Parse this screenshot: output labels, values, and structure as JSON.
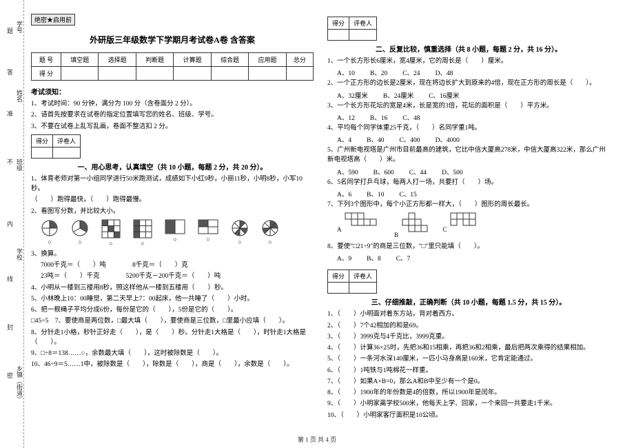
{
  "binding": {
    "fields": [
      "学号",
      "姓名",
      "班级",
      "学校",
      "乡镇（街道）"
    ],
    "marks": [
      "题",
      "答",
      "准",
      "不",
      "内",
      "线",
      "封",
      "密"
    ]
  },
  "secret": "绝密★启用前",
  "title": "外研版三年级数学下学期月考试卷A卷 含答案",
  "score_table": {
    "headers": [
      "题 号",
      "填空题",
      "选择题",
      "判断题",
      "计算题",
      "综合题",
      "应用题",
      "总分"
    ],
    "row2": "得 分"
  },
  "notice": {
    "head": "考试须知：",
    "items": [
      "1、考试时间：90 分钟，满分为 100 分（含卷面分 2 分）。",
      "2、请首先按要求在试卷的指定位置填写您的姓名、班级、学号。",
      "3、不要在试卷上乱写乱画，卷面不整洁扣 2 分。"
    ]
  },
  "scorebox": {
    "c1": "得分",
    "c2": "评卷人"
  },
  "sec1": {
    "title": "一、用心思考，认真填空（共 10 小题，每题 2 分，共 20 分）。",
    "q1a": "1、体育老师对第一小组同学进行50米跑测试，成绩如下小红9秒，小丽11秒，小明8秒，小军10秒。",
    "q1b": "（　　）跑得最快，（　　）跑得最慢。",
    "q2": "2、看图写分数，并比较大小。",
    "q3": "3、换算。",
    "q3a": "7000千克＝（　　）吨",
    "q3b": "8千克＝（　　）克",
    "q3c": "23吨＝（　　）千克",
    "q3d": "5200千克－200千克＝（　　）吨",
    "q4": "4、小明从一楼到三楼用8秒，照这样他从一楼到五楼用（　　）秒。",
    "q5": "5、小林晚上10：00睡觉，第二天早上7：00起床，他一共睡了（　　）小时。",
    "q6": "6、把一根绳子平均分成6份，每份是它的（　　），5份是它的（　　）。",
    "q7": "7、要使商是两位数，□最大填（　　），要使商是三位数，□里最小应填（　　）。",
    "q7a": "□45÷5",
    "q8": "8、分针走1小格，秒针正好走（　　），是（　　）秒。分针走1大格是（　　），时针走1大格是（　　）。",
    "q9": "9、□÷8＝138……○，余数最大填（　　），这时被除数是（　　）。",
    "q10": "10、46÷9＝5……1中，被除数是（　　），除数是（　　），商是（　　），余数是（　　）。"
  },
  "sec2": {
    "title": "二、反复比较，慎重选择（共 8 小题，每题 2 分，共 16 分）。",
    "q1": "1、一个长方形长6厘米，宽4厘米，它的周长是（　　）厘米。",
    "q1o": [
      "A、10",
      "B、20",
      "C、24",
      "D、48"
    ],
    "q2": "2、一个正方形的边长是2厘米，现在将边长扩大到原来的4倍，现在正方形的周长是（　　）。",
    "q2o": [
      "A、32厘米",
      "B、24厘米",
      "C、16厘米"
    ],
    "q3": "3、一个长方形花坛的宽是4米，长是宽的3倍，花坛的面积是（　　）平方米。",
    "q3o": [
      "A、12",
      "B、16",
      "C、48"
    ],
    "q4": "4、平均每个同学体重25千克，（　　）名同学重1吨。",
    "q4o": [
      "A、4",
      "B、40",
      "C、400",
      "D、4000"
    ],
    "q5": "5、广州新电视塔是广州市目前最高的建筑，它比中信大厦高278米，中信大厦高322米，那么广州新电视塔高（　　）米。",
    "q5o": [
      "A、590",
      "B、600",
      "C、44",
      "D、500"
    ],
    "q6": "6、5名同学打乒乓球，每两人打一场，共要打（　　）场。",
    "q6o": [
      "A、6",
      "B、10",
      "C、15"
    ],
    "q7": "7、下列3个图形中，每个小正方形都一样大，（　　）图形的周长最长。",
    "q7labels": [
      "A",
      "B",
      "C"
    ],
    "q8": "8、要使\"□21÷9\"的商是三位数，\"□\"里只能填（　　）。",
    "q8o": [
      "A、9",
      "B、8",
      "C、7"
    ]
  },
  "sec3": {
    "title": "三、仔细推敲，正确判断（共 10 小题，每题 1.5 分，共 15 分）。",
    "items": [
      "1、（　　）小明面对着东方站，背对着西方。",
      "2、（　　）7个42相加的和是69。",
      "3、（　　）3999克与4千克比，3999克重。",
      "4、（　　）计算36×25时，先把36和15相乘，再把36和2相乘，最后把两次乘得的结果相加。",
      "5、（　　）一条河水深140厘米，一匹小马身高是160米，它肯定能通过。",
      "6、（　　）1吨铁与1吨棉花一样重。",
      "7、（　　）如果A×B=0，那么A和B中至少有一个是0。",
      "8、（　　）1900年的年份数是4的倍数，所以1900年是闰年。",
      "9、（　　）小明家离学校500米，他每天上学、回家，一个来回一共要走1千米。",
      "10、（　　）小明家客厅面积是10公顷。"
    ]
  },
  "footer": "第 1 页 共 4 页"
}
